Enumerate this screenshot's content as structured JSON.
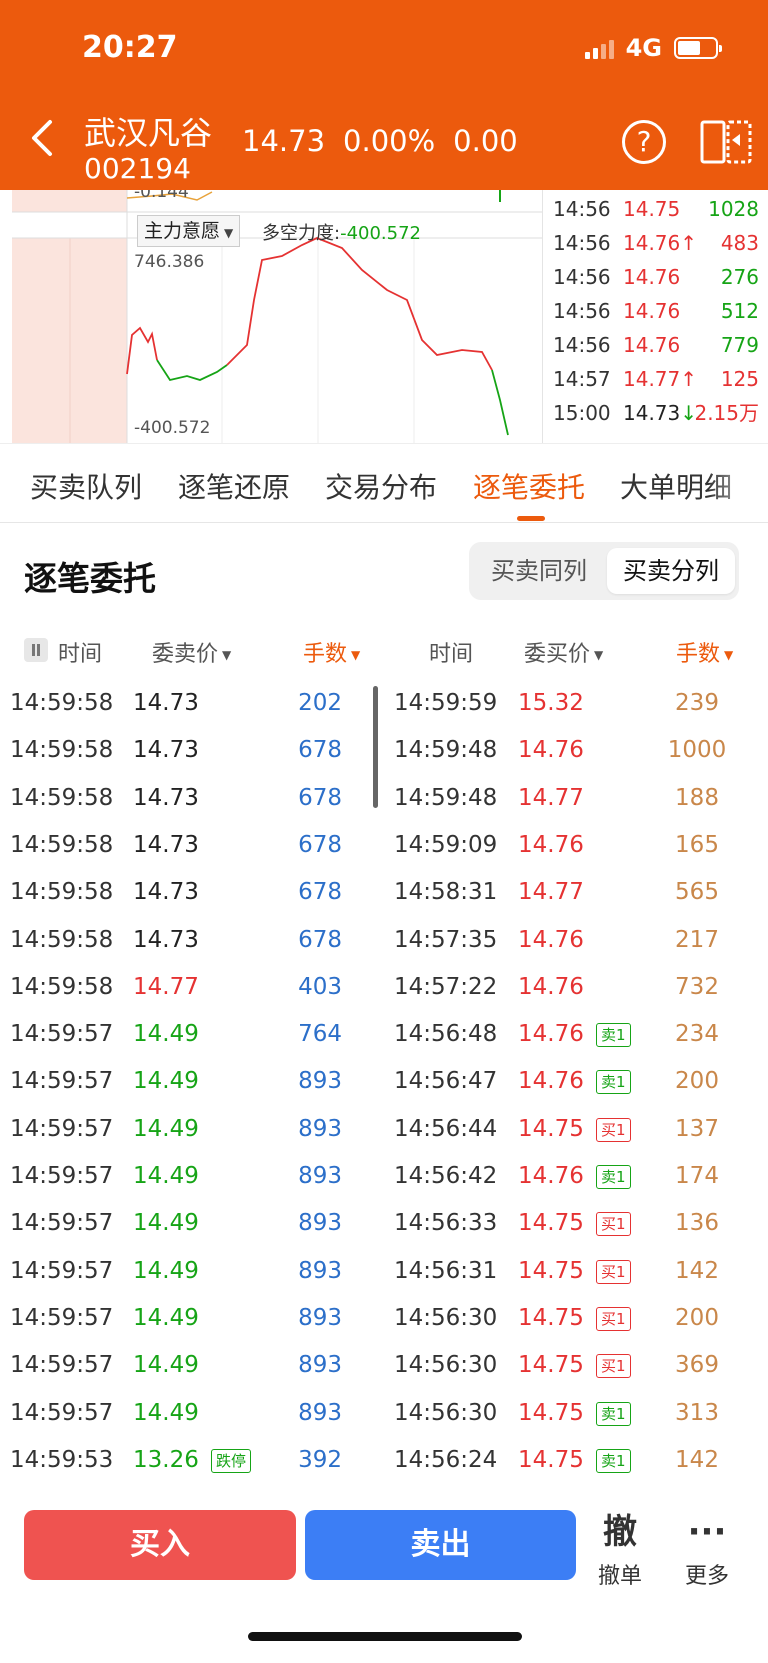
{
  "status_bar": {
    "time": "20:27",
    "network": "4G",
    "battery_level": 0.6
  },
  "header": {
    "name": "武汉凡谷",
    "code": "002194",
    "price": "14.73",
    "change_pct": "0.00%",
    "change": "0.00",
    "help_symbol": "?",
    "icons": [
      "back-icon",
      "help-icon",
      "switch-layout-icon"
    ]
  },
  "chart": {
    "top_clip_label": "-0.144",
    "indicator": "主力意愿",
    "dkl_label": "多空力度:",
    "dkl_value": "-400.572",
    "axis_top": "746.386",
    "axis_bottom": "-400.572"
  },
  "ticks": [
    {
      "time": "14:56",
      "price": "14.75",
      "arrow": "",
      "vol": "1028",
      "price_color": "red",
      "vol_color": "green"
    },
    {
      "time": "14:56",
      "price": "14.76",
      "arrow": "↑",
      "vol": "483",
      "price_color": "red",
      "vol_color": "red"
    },
    {
      "time": "14:56",
      "price": "14.76",
      "arrow": "",
      "vol": "276",
      "price_color": "red",
      "vol_color": "green"
    },
    {
      "time": "14:56",
      "price": "14.76",
      "arrow": "",
      "vol": "512",
      "price_color": "red",
      "vol_color": "green"
    },
    {
      "time": "14:56",
      "price": "14.76",
      "arrow": "",
      "vol": "779",
      "price_color": "red",
      "vol_color": "green"
    },
    {
      "time": "14:57",
      "price": "14.77",
      "arrow": "↑",
      "vol": "125",
      "price_color": "red",
      "vol_color": "red"
    },
    {
      "time": "15:00",
      "price": "14.73",
      "arrow": "↓",
      "vol": "2.15万",
      "price_color": "black",
      "vol_color": "red"
    }
  ],
  "tabs": [
    "买卖队列",
    "逐笔还原",
    "交易分布",
    "逐笔委托",
    "大单明细"
  ],
  "active_tab": 3,
  "section": {
    "title": "逐笔委托",
    "seg_options": [
      "买卖同列",
      "买卖分列"
    ],
    "seg_active": 1
  },
  "columns": {
    "sell_time": "时间",
    "sell_price": "委卖价",
    "sell_vol": "手数",
    "buy_time": "时间",
    "buy_price": "委买价",
    "buy_vol": "手数"
  },
  "rows": [
    {
      "s_time": "14:59:58",
      "s_price": "14.73",
      "s_color": "black",
      "s_badge": "",
      "s_vol": "202",
      "b_time": "14:59:59",
      "b_price": "15.32",
      "b_badge": "",
      "b_badge_type": "",
      "b_vol": "239"
    },
    {
      "s_time": "14:59:58",
      "s_price": "14.73",
      "s_color": "black",
      "s_badge": "",
      "s_vol": "678",
      "b_time": "14:59:48",
      "b_price": "14.76",
      "b_badge": "",
      "b_badge_type": "",
      "b_vol": "1000"
    },
    {
      "s_time": "14:59:58",
      "s_price": "14.73",
      "s_color": "black",
      "s_badge": "",
      "s_vol": "678",
      "b_time": "14:59:48",
      "b_price": "14.77",
      "b_badge": "",
      "b_badge_type": "",
      "b_vol": "188"
    },
    {
      "s_time": "14:59:58",
      "s_price": "14.73",
      "s_color": "black",
      "s_badge": "",
      "s_vol": "678",
      "b_time": "14:59:09",
      "b_price": "14.76",
      "b_badge": "",
      "b_badge_type": "",
      "b_vol": "165"
    },
    {
      "s_time": "14:59:58",
      "s_price": "14.73",
      "s_color": "black",
      "s_badge": "",
      "s_vol": "678",
      "b_time": "14:58:31",
      "b_price": "14.77",
      "b_badge": "",
      "b_badge_type": "",
      "b_vol": "565"
    },
    {
      "s_time": "14:59:58",
      "s_price": "14.73",
      "s_color": "black",
      "s_badge": "",
      "s_vol": "678",
      "b_time": "14:57:35",
      "b_price": "14.76",
      "b_badge": "",
      "b_badge_type": "",
      "b_vol": "217"
    },
    {
      "s_time": "14:59:58",
      "s_price": "14.77",
      "s_color": "red",
      "s_badge": "",
      "s_vol": "403",
      "b_time": "14:57:22",
      "b_price": "14.76",
      "b_badge": "",
      "b_badge_type": "",
      "b_vol": "732"
    },
    {
      "s_time": "14:59:57",
      "s_price": "14.49",
      "s_color": "green",
      "s_badge": "",
      "s_vol": "764",
      "b_time": "14:56:48",
      "b_price": "14.76",
      "b_badge": "卖1",
      "b_badge_type": "sell",
      "b_vol": "234"
    },
    {
      "s_time": "14:59:57",
      "s_price": "14.49",
      "s_color": "green",
      "s_badge": "",
      "s_vol": "893",
      "b_time": "14:56:47",
      "b_price": "14.76",
      "b_badge": "卖1",
      "b_badge_type": "sell",
      "b_vol": "200"
    },
    {
      "s_time": "14:59:57",
      "s_price": "14.49",
      "s_color": "green",
      "s_badge": "",
      "s_vol": "893",
      "b_time": "14:56:44",
      "b_price": "14.75",
      "b_badge": "买1",
      "b_badge_type": "buy",
      "b_vol": "137"
    },
    {
      "s_time": "14:59:57",
      "s_price": "14.49",
      "s_color": "green",
      "s_badge": "",
      "s_vol": "893",
      "b_time": "14:56:42",
      "b_price": "14.76",
      "b_badge": "卖1",
      "b_badge_type": "sell",
      "b_vol": "174"
    },
    {
      "s_time": "14:59:57",
      "s_price": "14.49",
      "s_color": "green",
      "s_badge": "",
      "s_vol": "893",
      "b_time": "14:56:33",
      "b_price": "14.75",
      "b_badge": "买1",
      "b_badge_type": "buy",
      "b_vol": "136"
    },
    {
      "s_time": "14:59:57",
      "s_price": "14.49",
      "s_color": "green",
      "s_badge": "",
      "s_vol": "893",
      "b_time": "14:56:31",
      "b_price": "14.75",
      "b_badge": "买1",
      "b_badge_type": "buy",
      "b_vol": "142"
    },
    {
      "s_time": "14:59:57",
      "s_price": "14.49",
      "s_color": "green",
      "s_badge": "",
      "s_vol": "893",
      "b_time": "14:56:30",
      "b_price": "14.75",
      "b_badge": "买1",
      "b_badge_type": "buy",
      "b_vol": "200"
    },
    {
      "s_time": "14:59:57",
      "s_price": "14.49",
      "s_color": "green",
      "s_badge": "",
      "s_vol": "893",
      "b_time": "14:56:30",
      "b_price": "14.75",
      "b_badge": "买1",
      "b_badge_type": "buy",
      "b_vol": "369"
    },
    {
      "s_time": "14:59:57",
      "s_price": "14.49",
      "s_color": "green",
      "s_badge": "",
      "s_vol": "893",
      "b_time": "14:56:30",
      "b_price": "14.75",
      "b_badge": "卖1",
      "b_badge_type": "sell",
      "b_vol": "313"
    },
    {
      "s_time": "14:59:53",
      "s_price": "13.26",
      "s_color": "green",
      "s_badge": "跌停",
      "s_vol": "392",
      "b_time": "14:56:24",
      "b_price": "14.75",
      "b_badge": "卖1",
      "b_badge_type": "sell",
      "b_vol": "142"
    }
  ],
  "bottom": {
    "buy": "买入",
    "sell": "卖出",
    "cancel_glyph": "撤",
    "cancel": "撤单",
    "more_glyph": "···",
    "more": "更多"
  },
  "colors": {
    "brand": "#ec5a0d",
    "red": "#e53232",
    "green": "#16a416",
    "blue": "#2c6fc9",
    "vol_orange": "#c9874a"
  }
}
